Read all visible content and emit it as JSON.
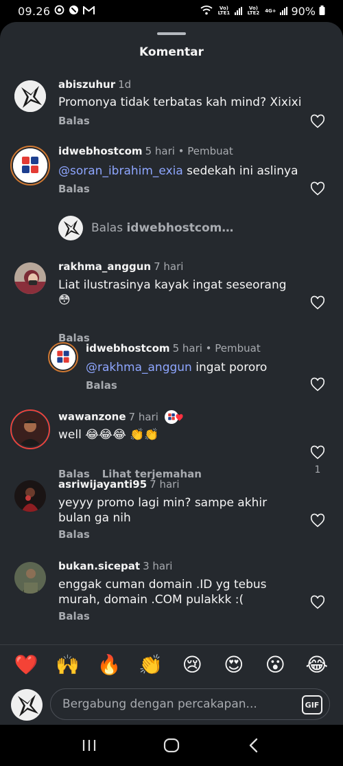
{
  "status_bar": {
    "time": "09.26",
    "sim1_label": "Vo) LTE1",
    "sim2_label": "Vo) LTE2",
    "network": "4G+",
    "battery": "90%"
  },
  "sheet": {
    "title": "Komentar"
  },
  "comments": [
    {
      "username": "abiszuhur",
      "meta": "1d",
      "text": "Promonya tidak terbatas kah mind? Xixixi",
      "reply_label": "Balas"
    },
    {
      "username": "idwebhostcom",
      "meta": "5 hari • Pembuat",
      "mention": "@soran_ibrahim_exia",
      "text": " sedekah ini aslinya",
      "reply_label": "Balas"
    },
    {
      "username": "rakhma_anggun",
      "meta": "7 hari",
      "text": "Liat ilustrasinya kayak ingat seseorang",
      "emoji": "😳",
      "reply_label": "Balas"
    },
    {
      "username": "idwebhostcom",
      "meta": "5 hari • Pembuat",
      "mention": "@rakhma_anggun",
      "text": " ingat pororo",
      "reply_label": "Balas"
    },
    {
      "username": "wawanzone",
      "meta": "7 hari",
      "text": "well 😂😂😂 👏👏",
      "reply_label": "Balas",
      "translate_label": "Lihat terjemahan",
      "likes": "1"
    },
    {
      "username": "asriwijayanti95",
      "meta": "7 hari",
      "text": "yeyyy promo lagi min? sampe akhir bulan ga nih",
      "reply_label": "Balas"
    },
    {
      "username": "bukan.sicepat",
      "meta": "3 hari",
      "text": "enggak cuman domain .ID yg tebus murah, domain .COM pulakkk :(",
      "reply_label": "Balas"
    }
  ],
  "reply_prompt": {
    "prefix": "Balas ",
    "username": "idwebhostcom…"
  },
  "emoji_bar": [
    "❤️",
    "🙌",
    "🔥",
    "👏",
    "😢",
    "😍",
    "😮",
    "😂"
  ],
  "input": {
    "placeholder": "Bergabung dengan percakapan...",
    "gif_label": "GIF"
  },
  "colors": {
    "background": "#25292e",
    "mention": "#8ea6ff",
    "muted": "#a8abb0",
    "story_ring": "#e8443e"
  }
}
